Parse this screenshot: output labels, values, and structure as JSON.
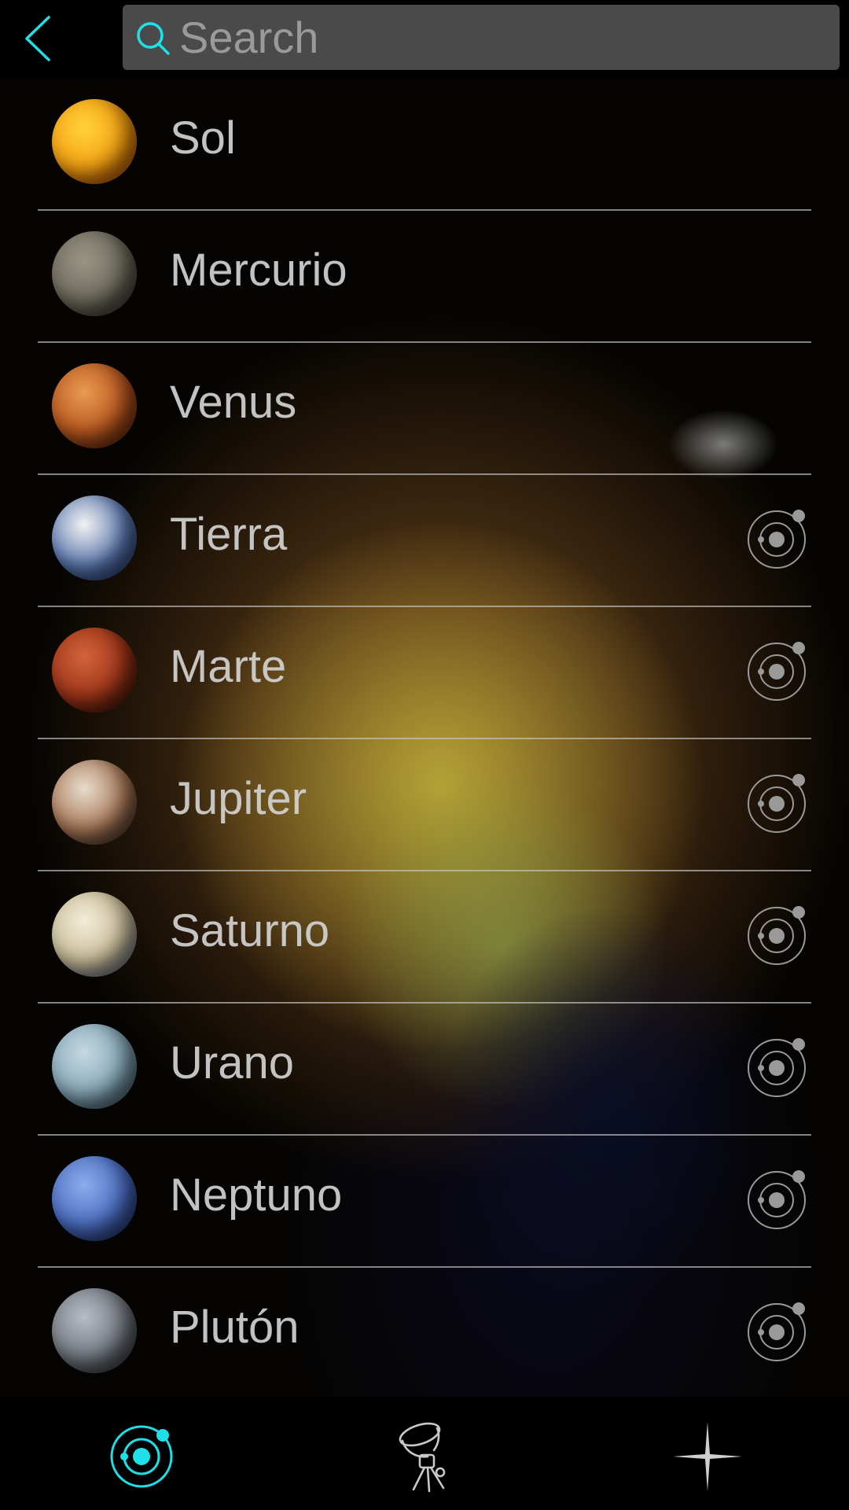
{
  "search": {
    "placeholder": "Search",
    "value": ""
  },
  "bodies": [
    {
      "name": "Sol",
      "has_orbit": false,
      "colors": [
        "#ffd23a",
        "#f5a011",
        "#c8470a"
      ]
    },
    {
      "name": "Mercurio",
      "has_orbit": false,
      "colors": [
        "#9a9484",
        "#6e6a5c",
        "#3a3830"
      ]
    },
    {
      "name": "Venus",
      "has_orbit": false,
      "colors": [
        "#e89a52",
        "#b8561e",
        "#5a2208"
      ]
    },
    {
      "name": "Tierra",
      "has_orbit": true,
      "colors": [
        "#f2f2f2",
        "#5d7ab0",
        "#1e3a78"
      ]
    },
    {
      "name": "Marte",
      "has_orbit": true,
      "colors": [
        "#d2643c",
        "#9e3418",
        "#3a1208"
      ]
    },
    {
      "name": "Jupiter",
      "has_orbit": true,
      "colors": [
        "#e8dccc",
        "#a87858",
        "#3c2a20"
      ]
    },
    {
      "name": "Saturno",
      "has_orbit": true,
      "colors": [
        "#f2ecd8",
        "#c8bc98",
        "#5a6e9a"
      ]
    },
    {
      "name": "Urano",
      "has_orbit": true,
      "colors": [
        "#c4d8e2",
        "#86a8b8",
        "#3c5662"
      ]
    },
    {
      "name": "Neptuno",
      "has_orbit": true,
      "colors": [
        "#8cacec",
        "#4a6cc0",
        "#1e2e6a"
      ]
    },
    {
      "name": "Plutón",
      "has_orbit": true,
      "colors": [
        "#b8bcc4",
        "#727880",
        "#2a2c30"
      ]
    }
  ],
  "colors": {
    "accent": "#1ee0e6",
    "text": "#d2d2d2",
    "search_bg": "#4a4a4a",
    "orbit_icon": "#9a9a9a"
  },
  "tabs": [
    {
      "icon": "solar-system-icon",
      "active": true
    },
    {
      "icon": "telescope-icon",
      "active": false
    },
    {
      "icon": "star-icon",
      "active": false
    }
  ]
}
